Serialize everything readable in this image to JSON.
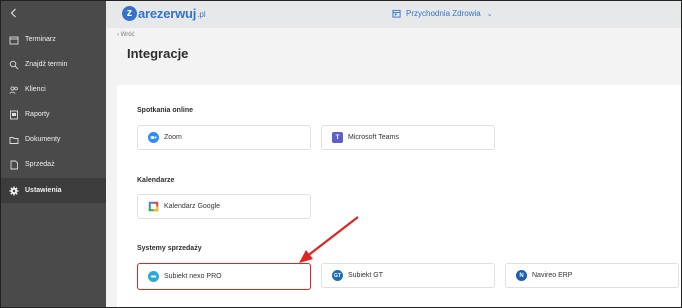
{
  "sidebar": {
    "back_icon": "chevron-left-icon",
    "items": [
      {
        "label": "Terminarz",
        "icon": "calendar-icon"
      },
      {
        "label": "Znajdź termin",
        "icon": "search-icon"
      },
      {
        "label": "Klienci",
        "icon": "users-icon"
      },
      {
        "label": "Raporty",
        "icon": "report-icon"
      },
      {
        "label": "Dokumenty",
        "icon": "folder-icon"
      },
      {
        "label": "Sprzedaż",
        "icon": "document-icon"
      },
      {
        "label": "Ustawienia",
        "icon": "gear-icon",
        "active": true
      }
    ]
  },
  "topbar": {
    "logo_letter": "z",
    "logo_text": "arezerwuj",
    "logo_suffix": ".pl",
    "clinic_name": "Przychodnia Zdrowia"
  },
  "page": {
    "back_label": "Wróć",
    "title": "Integracje"
  },
  "sections": {
    "online": {
      "title": "Spotkania online",
      "cards": [
        {
          "label": "Zoom",
          "icon": "zoom-icon",
          "color": "#2d8cff"
        },
        {
          "label": "Microsoft Teams",
          "icon": "teams-icon",
          "color": "#5b5fc7"
        }
      ]
    },
    "calendars": {
      "title": "Kalendarze",
      "cards": [
        {
          "label": "Kalendarz Google",
          "icon": "google-calendar-icon",
          "color": "#4285f4"
        }
      ]
    },
    "sales": {
      "title": "Systemy sprzedaży",
      "cards": [
        {
          "label": "Subiekt nexo PRO",
          "icon": "subiekt-nexo-icon",
          "color": "#2aa8d6"
        },
        {
          "label": "Subiekt GT",
          "icon": "subiekt-gt-icon",
          "color": "#1f6fb5"
        },
        {
          "label": "Navireo ERP",
          "icon": "navireo-icon",
          "color": "#1b5db0"
        }
      ]
    }
  },
  "colors": {
    "accent": "#3573c9",
    "highlight": "#e02424",
    "sidebar_bg": "#4a4a4a"
  }
}
